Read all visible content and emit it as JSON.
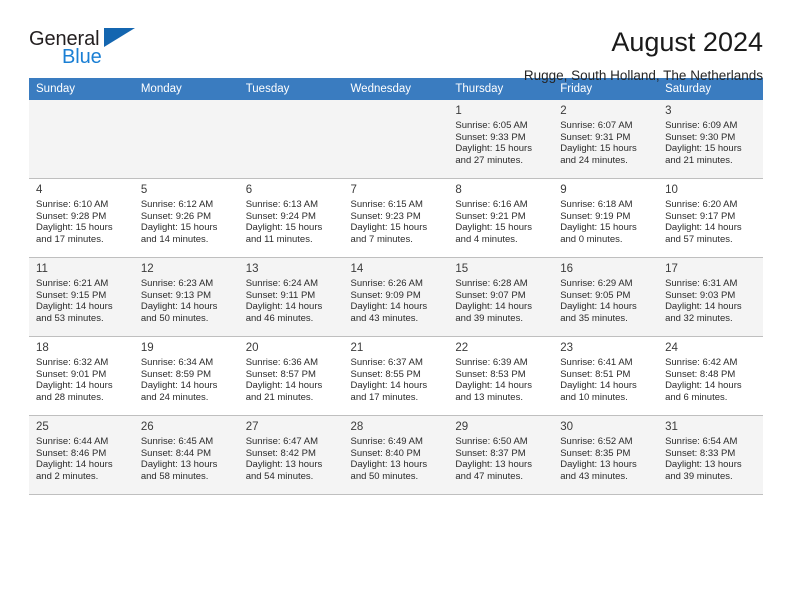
{
  "brand": {
    "line1": "General",
    "line2": "Blue",
    "triangle_color": "#1466b0",
    "blue_color": "#1a7fd4"
  },
  "header": {
    "title": "August 2024",
    "subtitle": "Rugge, South Holland, The Netherlands"
  },
  "theme": {
    "header_bg": "#3a7cc0",
    "header_text": "#ffffff",
    "row_shaded_bg": "#f4f4f4",
    "row_plain_bg": "#ffffff",
    "grid_line": "#bfbfbf"
  },
  "weekdays": [
    "Sunday",
    "Monday",
    "Tuesday",
    "Wednesday",
    "Thursday",
    "Friday",
    "Saturday"
  ],
  "weeks": [
    [
      {
        "day": "",
        "sunrise": "",
        "sunset": "",
        "daylight1": "",
        "daylight2": ""
      },
      {
        "day": "",
        "sunrise": "",
        "sunset": "",
        "daylight1": "",
        "daylight2": ""
      },
      {
        "day": "",
        "sunrise": "",
        "sunset": "",
        "daylight1": "",
        "daylight2": ""
      },
      {
        "day": "",
        "sunrise": "",
        "sunset": "",
        "daylight1": "",
        "daylight2": ""
      },
      {
        "day": "1",
        "sunrise": "Sunrise: 6:05 AM",
        "sunset": "Sunset: 9:33 PM",
        "daylight1": "Daylight: 15 hours",
        "daylight2": "and 27 minutes."
      },
      {
        "day": "2",
        "sunrise": "Sunrise: 6:07 AM",
        "sunset": "Sunset: 9:31 PM",
        "daylight1": "Daylight: 15 hours",
        "daylight2": "and 24 minutes."
      },
      {
        "day": "3",
        "sunrise": "Sunrise: 6:09 AM",
        "sunset": "Sunset: 9:30 PM",
        "daylight1": "Daylight: 15 hours",
        "daylight2": "and 21 minutes."
      }
    ],
    [
      {
        "day": "4",
        "sunrise": "Sunrise: 6:10 AM",
        "sunset": "Sunset: 9:28 PM",
        "daylight1": "Daylight: 15 hours",
        "daylight2": "and 17 minutes."
      },
      {
        "day": "5",
        "sunrise": "Sunrise: 6:12 AM",
        "sunset": "Sunset: 9:26 PM",
        "daylight1": "Daylight: 15 hours",
        "daylight2": "and 14 minutes."
      },
      {
        "day": "6",
        "sunrise": "Sunrise: 6:13 AM",
        "sunset": "Sunset: 9:24 PM",
        "daylight1": "Daylight: 15 hours",
        "daylight2": "and 11 minutes."
      },
      {
        "day": "7",
        "sunrise": "Sunrise: 6:15 AM",
        "sunset": "Sunset: 9:23 PM",
        "daylight1": "Daylight: 15 hours",
        "daylight2": "and 7 minutes."
      },
      {
        "day": "8",
        "sunrise": "Sunrise: 6:16 AM",
        "sunset": "Sunset: 9:21 PM",
        "daylight1": "Daylight: 15 hours",
        "daylight2": "and 4 minutes."
      },
      {
        "day": "9",
        "sunrise": "Sunrise: 6:18 AM",
        "sunset": "Sunset: 9:19 PM",
        "daylight1": "Daylight: 15 hours",
        "daylight2": "and 0 minutes."
      },
      {
        "day": "10",
        "sunrise": "Sunrise: 6:20 AM",
        "sunset": "Sunset: 9:17 PM",
        "daylight1": "Daylight: 14 hours",
        "daylight2": "and 57 minutes."
      }
    ],
    [
      {
        "day": "11",
        "sunrise": "Sunrise: 6:21 AM",
        "sunset": "Sunset: 9:15 PM",
        "daylight1": "Daylight: 14 hours",
        "daylight2": "and 53 minutes."
      },
      {
        "day": "12",
        "sunrise": "Sunrise: 6:23 AM",
        "sunset": "Sunset: 9:13 PM",
        "daylight1": "Daylight: 14 hours",
        "daylight2": "and 50 minutes."
      },
      {
        "day": "13",
        "sunrise": "Sunrise: 6:24 AM",
        "sunset": "Sunset: 9:11 PM",
        "daylight1": "Daylight: 14 hours",
        "daylight2": "and 46 minutes."
      },
      {
        "day": "14",
        "sunrise": "Sunrise: 6:26 AM",
        "sunset": "Sunset: 9:09 PM",
        "daylight1": "Daylight: 14 hours",
        "daylight2": "and 43 minutes."
      },
      {
        "day": "15",
        "sunrise": "Sunrise: 6:28 AM",
        "sunset": "Sunset: 9:07 PM",
        "daylight1": "Daylight: 14 hours",
        "daylight2": "and 39 minutes."
      },
      {
        "day": "16",
        "sunrise": "Sunrise: 6:29 AM",
        "sunset": "Sunset: 9:05 PM",
        "daylight1": "Daylight: 14 hours",
        "daylight2": "and 35 minutes."
      },
      {
        "day": "17",
        "sunrise": "Sunrise: 6:31 AM",
        "sunset": "Sunset: 9:03 PM",
        "daylight1": "Daylight: 14 hours",
        "daylight2": "and 32 minutes."
      }
    ],
    [
      {
        "day": "18",
        "sunrise": "Sunrise: 6:32 AM",
        "sunset": "Sunset: 9:01 PM",
        "daylight1": "Daylight: 14 hours",
        "daylight2": "and 28 minutes."
      },
      {
        "day": "19",
        "sunrise": "Sunrise: 6:34 AM",
        "sunset": "Sunset: 8:59 PM",
        "daylight1": "Daylight: 14 hours",
        "daylight2": "and 24 minutes."
      },
      {
        "day": "20",
        "sunrise": "Sunrise: 6:36 AM",
        "sunset": "Sunset: 8:57 PM",
        "daylight1": "Daylight: 14 hours",
        "daylight2": "and 21 minutes."
      },
      {
        "day": "21",
        "sunrise": "Sunrise: 6:37 AM",
        "sunset": "Sunset: 8:55 PM",
        "daylight1": "Daylight: 14 hours",
        "daylight2": "and 17 minutes."
      },
      {
        "day": "22",
        "sunrise": "Sunrise: 6:39 AM",
        "sunset": "Sunset: 8:53 PM",
        "daylight1": "Daylight: 14 hours",
        "daylight2": "and 13 minutes."
      },
      {
        "day": "23",
        "sunrise": "Sunrise: 6:41 AM",
        "sunset": "Sunset: 8:51 PM",
        "daylight1": "Daylight: 14 hours",
        "daylight2": "and 10 minutes."
      },
      {
        "day": "24",
        "sunrise": "Sunrise: 6:42 AM",
        "sunset": "Sunset: 8:48 PM",
        "daylight1": "Daylight: 14 hours",
        "daylight2": "and 6 minutes."
      }
    ],
    [
      {
        "day": "25",
        "sunrise": "Sunrise: 6:44 AM",
        "sunset": "Sunset: 8:46 PM",
        "daylight1": "Daylight: 14 hours",
        "daylight2": "and 2 minutes."
      },
      {
        "day": "26",
        "sunrise": "Sunrise: 6:45 AM",
        "sunset": "Sunset: 8:44 PM",
        "daylight1": "Daylight: 13 hours",
        "daylight2": "and 58 minutes."
      },
      {
        "day": "27",
        "sunrise": "Sunrise: 6:47 AM",
        "sunset": "Sunset: 8:42 PM",
        "daylight1": "Daylight: 13 hours",
        "daylight2": "and 54 minutes."
      },
      {
        "day": "28",
        "sunrise": "Sunrise: 6:49 AM",
        "sunset": "Sunset: 8:40 PM",
        "daylight1": "Daylight: 13 hours",
        "daylight2": "and 50 minutes."
      },
      {
        "day": "29",
        "sunrise": "Sunrise: 6:50 AM",
        "sunset": "Sunset: 8:37 PM",
        "daylight1": "Daylight: 13 hours",
        "daylight2": "and 47 minutes."
      },
      {
        "day": "30",
        "sunrise": "Sunrise: 6:52 AM",
        "sunset": "Sunset: 8:35 PM",
        "daylight1": "Daylight: 13 hours",
        "daylight2": "and 43 minutes."
      },
      {
        "day": "31",
        "sunrise": "Sunrise: 6:54 AM",
        "sunset": "Sunset: 8:33 PM",
        "daylight1": "Daylight: 13 hours",
        "daylight2": "and 39 minutes."
      }
    ]
  ]
}
